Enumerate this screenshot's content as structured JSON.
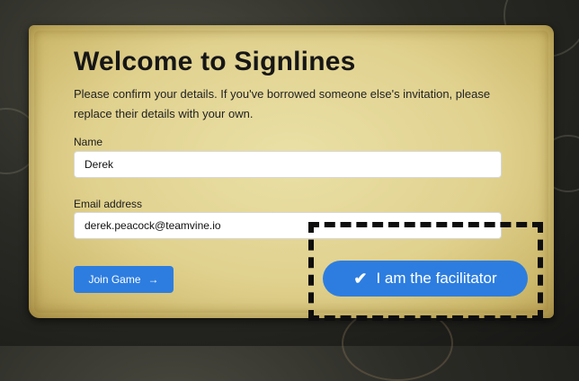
{
  "form": {
    "title": "Welcome to Signlines",
    "intro": "Please confirm your details. If you've borrowed someone else's invitation, please replace their details with your own.",
    "name_label": "Name",
    "name_value": "Derek",
    "email_label": "Email address",
    "email_value": "derek.peacock@teamvine.io",
    "join_button": "Join Game",
    "join_icon": "arrow-right-icon"
  },
  "facilitator": {
    "label": "I am the facilitator",
    "icon": "check-icon",
    "color": "#2d7de0"
  },
  "colors": {
    "accent": "#2d7de0",
    "parchment": "#e4d697",
    "highlight_border": "#0e0e0e"
  }
}
